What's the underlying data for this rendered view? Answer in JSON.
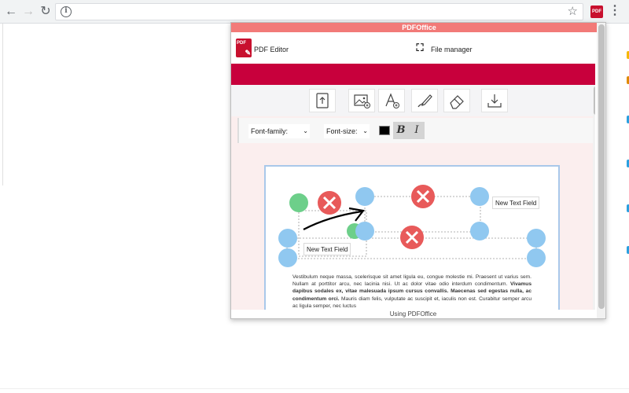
{
  "browser": {
    "back": "←",
    "forward": "→",
    "reload": "↻",
    "info": "i",
    "star": "☆",
    "extension": "PDF",
    "menu": "⋮"
  },
  "popup": {
    "title": "PDFOffice",
    "header": {
      "app_label": "PDF Editor",
      "file_manager_label": "File manager"
    },
    "toolbar": {
      "tools": [
        {
          "icon": "upload-icon"
        },
        {
          "icon": "add-image-icon"
        },
        {
          "icon": "add-text-icon"
        },
        {
          "icon": "draw-icon"
        },
        {
          "icon": "eraser-icon"
        },
        {
          "icon": "download-icon"
        }
      ]
    },
    "format": {
      "font_family_label": "Font-family:",
      "font_size_label": "Font-size:",
      "color": "#000000",
      "bold_label": "B",
      "italic_label": "I"
    },
    "document": {
      "text_field_1": "New Text Field",
      "text_field_2": "New Text Field",
      "paragraph_1": "Vestibulum neque massa, scelerisque sit amet ligula eu, congue molestie mi. Praesent ut varius sem. Nullam at porttitor arcu, nec lacinia nisi. Ut ac dolor vitae odio interdum condimentum. ",
      "paragraph_bold": "Vivamus dapibus sodales ex, vitae malesuada ipsum cursus convallis. Maecenas sed egestas nulla, ac condimentum orci.",
      "paragraph_2": " Mauris diam felis, vulputate ac suscipit et, iaculis non est. Curabitur semper arcu ac ligula semper, nec luctus"
    },
    "footer": "Using PDFOffice"
  },
  "colors": {
    "titlebar": "#f27a78",
    "brand_red": "#c8003c",
    "handle_blue": "#90c8f0",
    "delete_red": "#e85a5a",
    "handle_green": "#6dcf8a"
  }
}
